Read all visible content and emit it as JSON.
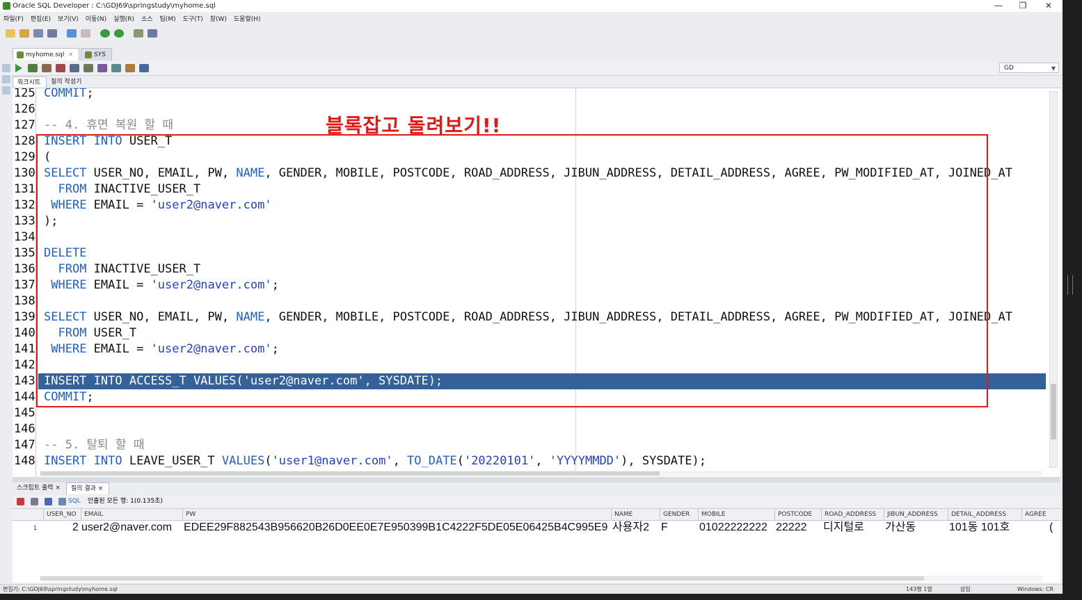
{
  "window": {
    "title": "Oracle SQL Developer : C:\\GDJ69\\springstudy\\myhome.sql",
    "controls": [
      "—",
      "❐",
      "✕"
    ]
  },
  "menu": [
    "파일(F)",
    "편집(E)",
    "보기(V)",
    "이동(N)",
    "실행(R)",
    "소스",
    "팀(M)",
    "도구(T)",
    "창(W)",
    "도움말(H)"
  ],
  "tabs": [
    {
      "label": "myhome.sql",
      "active": true
    },
    {
      "label": "SYS",
      "active": false
    }
  ],
  "connection": "GD",
  "subtabs": [
    "워크시트",
    "질의 작성기"
  ],
  "annotation": "블록잡고 돌려보기!!",
  "editor_lines": [
    {
      "n": "125",
      "html": "<span class=\"kw\">COMMIT</span>;"
    },
    {
      "n": "126",
      "html": ""
    },
    {
      "n": "127",
      "html": "<span class=\"cm\">-- 4. 휴면 복원 할 때</span>"
    },
    {
      "n": "128",
      "html": "<span class=\"kw\">INSERT INTO</span> USER_T"
    },
    {
      "n": "129",
      "html": "("
    },
    {
      "n": "130",
      "html": "<span class=\"kw\">SELECT</span> USER_NO, EMAIL, PW, <span class=\"kw\">NAME</span>, GENDER, MOBILE, POSTCODE, ROAD_ADDRESS, JIBUN_ADDRESS, DETAIL_ADDRESS, AGREE, PW_MODIFIED_AT, JOINED_AT"
    },
    {
      "n": "131",
      "html": "  <span class=\"kw\">FROM</span> INACTIVE_USER_T"
    },
    {
      "n": "132",
      "html": " <span class=\"kw\">WHERE</span> EMAIL = <span class=\"str\">'user2@naver.com'</span>"
    },
    {
      "n": "133",
      "html": ");"
    },
    {
      "n": "134",
      "html": ""
    },
    {
      "n": "135",
      "html": "<span class=\"kw\">DELETE</span>"
    },
    {
      "n": "136",
      "html": "  <span class=\"kw\">FROM</span> INACTIVE_USER_T"
    },
    {
      "n": "137",
      "html": " <span class=\"kw\">WHERE</span> EMAIL = <span class=\"str\">'user2@naver.com'</span>;"
    },
    {
      "n": "138",
      "html": ""
    },
    {
      "n": "139",
      "html": "<span class=\"kw\">SELECT</span> USER_NO, EMAIL, PW, <span class=\"kw\">NAME</span>, GENDER, MOBILE, POSTCODE, ROAD_ADDRESS, JIBUN_ADDRESS, DETAIL_ADDRESS, AGREE, PW_MODIFIED_AT, JOINED_AT"
    },
    {
      "n": "140",
      "html": "  <span class=\"kw\">FROM</span> USER_T"
    },
    {
      "n": "141",
      "html": " <span class=\"kw\">WHERE</span> EMAIL = <span class=\"str\">'user2@naver.com'</span>;"
    },
    {
      "n": "142",
      "html": ""
    },
    {
      "n": "143",
      "html": "<span class=\"kw\">INSERT INTO</span> ACCESS_T VALUES('user2@naver.com', SYSDATE);",
      "highlight": true
    },
    {
      "n": "144",
      "html": "<span class=\"kw\">COMMIT</span>;"
    },
    {
      "n": "145",
      "html": ""
    },
    {
      "n": "146",
      "html": ""
    },
    {
      "n": "147",
      "html": "<span class=\"cm\">-- 5. 탈퇴 할 때</span>"
    },
    {
      "n": "148",
      "html": "<span class=\"kw\">INSERT INTO</span> LEAVE_USER_T <span class=\"kw\">VALUES</span>(<span class=\"str\">'user1@naver.com'</span>, <span class=\"kw\">TO_DATE</span>(<span class=\"str\">'20220101'</span>, <span class=\"str\">'YYYYMMDD'</span>), SYSDATE);"
    }
  ],
  "output_tabs": [
    "스크립트 출력 ×",
    "질의 결과 ×"
  ],
  "output_toolbar": {
    "sql_label": "SQL",
    "status": "인출된 모든 행: 1(0.135초)"
  },
  "grid": {
    "columns": [
      "USER_NO",
      "EMAIL",
      "PW",
      "NAME",
      "GENDER",
      "MOBILE",
      "POSTCODE",
      "ROAD_ADDRESS",
      "JIBUN_ADDRESS",
      "DETAIL_ADDRESS",
      "AGREE"
    ],
    "row": {
      "rownum": "1",
      "user_no": "2",
      "email": "user2@naver.com",
      "pw": "EDEE29F882543B956620B26D0EE0E7E950399B1C4222F5DE05E06425B4C995E9",
      "name": "사용자2",
      "gender": "F",
      "mobile": "01022222222",
      "postcode": "22222",
      "road_address": "디지털로",
      "jibun_address": "가산동",
      "detail_address": "101동 101호",
      "agree": "("
    }
  },
  "statusbar": {
    "path": "편집기: C:\\GDJ69\\springstudy\\myhome.sql",
    "position": "143행 1열",
    "mode": "삽입",
    "os": "Windows: CR"
  }
}
